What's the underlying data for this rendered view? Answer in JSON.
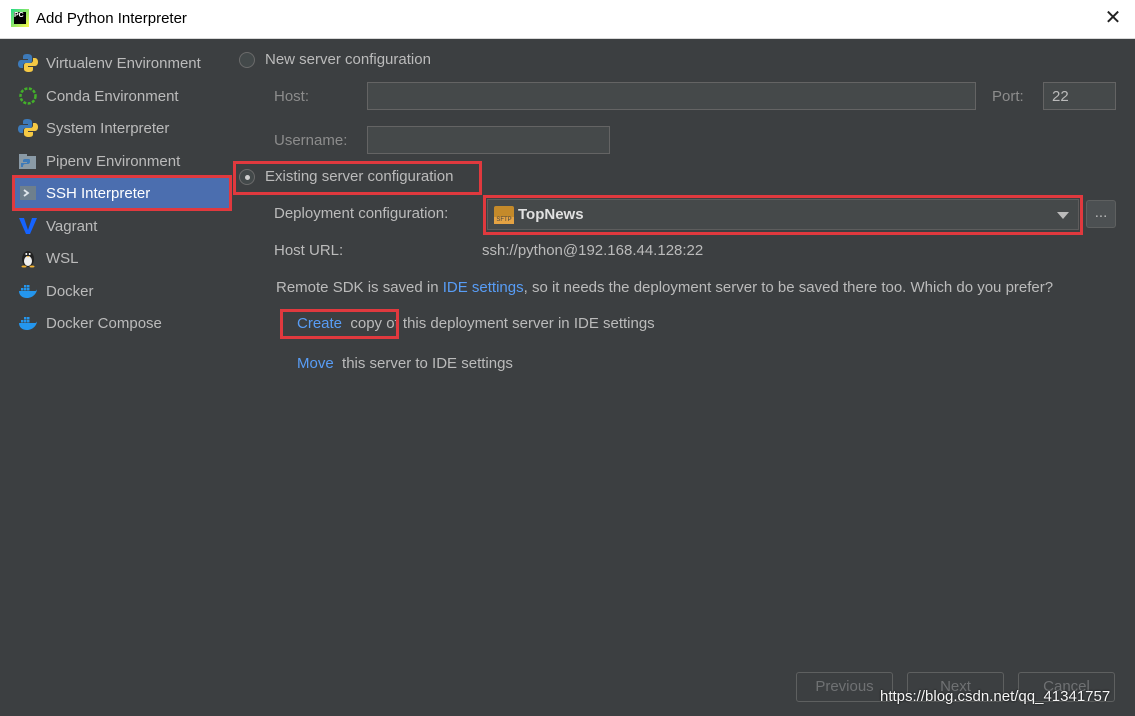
{
  "window": {
    "title": "Add Python Interpreter",
    "close_glyph": "✕",
    "app_icon_text": "PC"
  },
  "sidebar": {
    "items": [
      {
        "label": "Virtualenv Environment",
        "icon": "virtualenv-icon"
      },
      {
        "label": "Conda Environment",
        "icon": "conda-icon"
      },
      {
        "label": "System Interpreter",
        "icon": "python-icon"
      },
      {
        "label": "Pipenv Environment",
        "icon": "pipenv-icon"
      },
      {
        "label": "SSH Interpreter",
        "icon": "ssh-icon",
        "selected": true
      },
      {
        "label": "Vagrant",
        "icon": "vagrant-icon"
      },
      {
        "label": "WSL",
        "icon": "linux-penguin-icon"
      },
      {
        "label": "Docker",
        "icon": "docker-icon"
      },
      {
        "label": "Docker Compose",
        "icon": "docker-compose-icon"
      }
    ]
  },
  "main": {
    "new_server": {
      "label": "New server configuration",
      "host_label": "Host:",
      "host_value": "",
      "port_label": "Port:",
      "port_value": "22",
      "username_label": "Username:",
      "username_value": ""
    },
    "existing_server": {
      "label": "Existing server configuration",
      "selected": true,
      "deployment_label": "Deployment configuration:",
      "deployment_value": "TopNews",
      "browse_label": "...",
      "host_url_label": "Host URL:",
      "host_url_value": "ssh://python@192.168.44.128:22"
    },
    "notice": {
      "prefix": "Remote SDK is saved in ",
      "link": "IDE settings",
      "suffix": ", so it needs the deployment server to be saved there too. Which do you prefer?"
    },
    "options": [
      {
        "link": "Create",
        "text": "copy of this deployment server in IDE settings"
      },
      {
        "link": "Move",
        "text": "this server to IDE settings"
      }
    ]
  },
  "footer": {
    "previous": "Previous",
    "next": "Next",
    "cancel": "Cancel"
  },
  "watermark": "https://blog.csdn.net/qq_41341757",
  "colors": {
    "background": "#3c3f41",
    "selection": "#4b6eaf",
    "link": "#589df6",
    "highlight": "#e0393e"
  }
}
